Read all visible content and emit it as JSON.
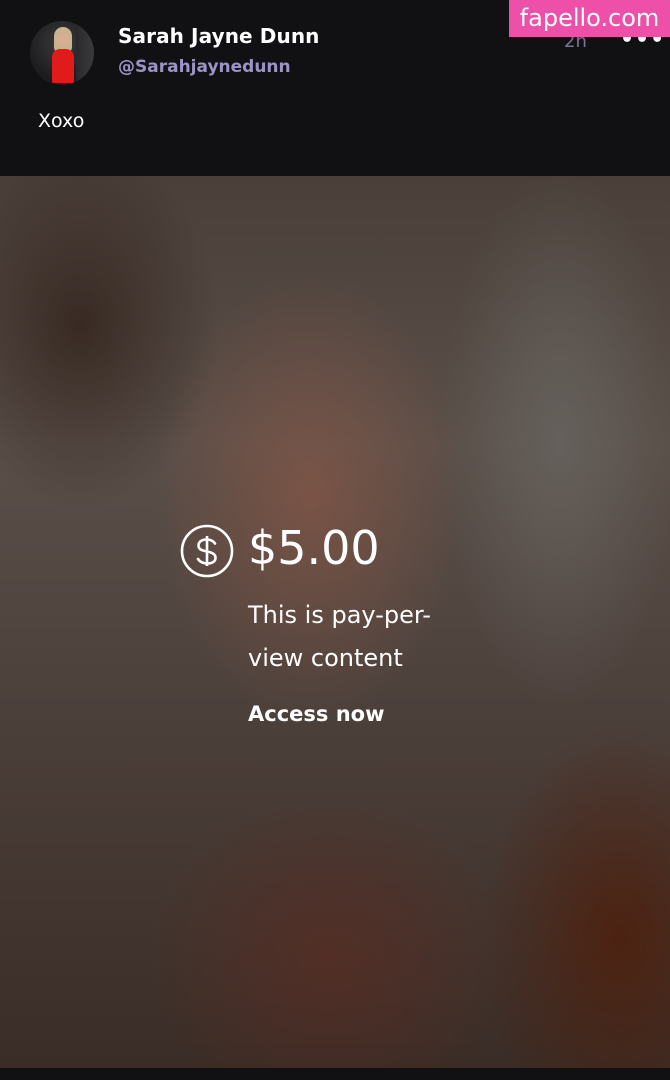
{
  "watermark": {
    "text": "fapello.com",
    "color": "#ee4fa9"
  },
  "post": {
    "author": {
      "display_name": "Sarah Jayne Dunn",
      "handle": "@Sarahjaynedunn"
    },
    "time_ago": "2h",
    "more_icon": "more-horizontal-icon",
    "caption": "Xoxo"
  },
  "locked_media": {
    "icon": "dollar-circle-icon",
    "price": "$5.00",
    "description": "This is pay-per- view content",
    "cta_label": "Access now"
  },
  "colors": {
    "background": "#111113",
    "handle": "#9c93c7",
    "time": "#7a7690",
    "text": "#ffffff"
  }
}
